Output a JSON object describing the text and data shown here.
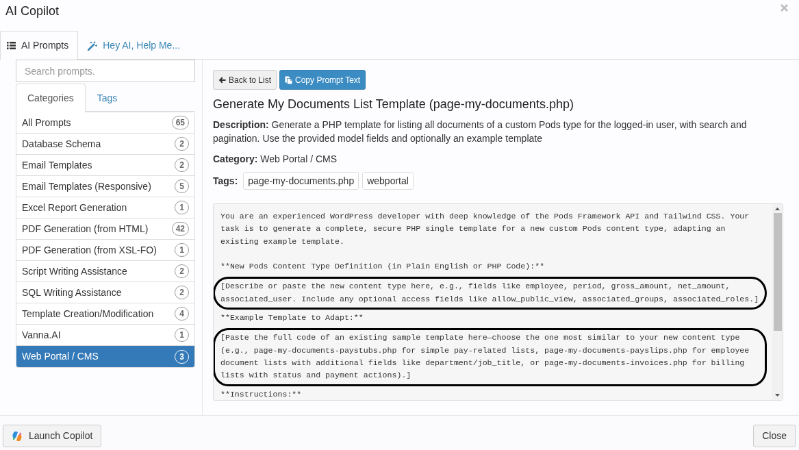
{
  "dialog": {
    "title": "AI Copilot"
  },
  "tabs": [
    {
      "label": "AI Prompts",
      "selected": true
    },
    {
      "label": "Hey AI, Help Me...",
      "selected": false
    }
  ],
  "sidebar": {
    "search": {
      "placeholder": "Search prompts."
    },
    "tabs": [
      {
        "label": "Categories",
        "selected": true
      },
      {
        "label": "Tags",
        "selected": false
      }
    ],
    "categories": [
      {
        "label": "All Prompts",
        "count": "65",
        "selected": false
      },
      {
        "label": "Database Schema",
        "count": "2",
        "selected": false
      },
      {
        "label": "Email Templates",
        "count": "2",
        "selected": false
      },
      {
        "label": "Email Templates (Responsive)",
        "count": "5",
        "selected": false
      },
      {
        "label": "Excel Report Generation",
        "count": "1",
        "selected": false
      },
      {
        "label": "PDF Generation (from HTML)",
        "count": "42",
        "selected": false
      },
      {
        "label": "PDF Generation (from XSL-FO)",
        "count": "1",
        "selected": false
      },
      {
        "label": "Script Writing Assistance",
        "count": "2",
        "selected": false
      },
      {
        "label": "SQL Writing Assistance",
        "count": "2",
        "selected": false
      },
      {
        "label": "Template Creation/Modification",
        "count": "4",
        "selected": false
      },
      {
        "label": "Vanna.AI",
        "count": "1",
        "selected": false
      },
      {
        "label": "Web Portal / CMS",
        "count": "3",
        "selected": true
      }
    ]
  },
  "detail": {
    "buttons": [
      {
        "label": "Back to List",
        "kind": "back"
      },
      {
        "label": "Copy Prompt Text",
        "kind": "copy"
      }
    ],
    "title": "Generate My Documents List Template (page-my-documents.php)",
    "description": "**Description:** Generate a PHP template for listing all documents of a custom Pods type for the logged-in user, with search and pagination. Use the provided model fields and optionally an example template",
    "category": "**Category:** Web Portal / CMS",
    "tags_label": "Tags:",
    "tags": [
      "page-my-documents.php",
      "webportal"
    ],
    "prompt": [
      {
        "text": "You are an experienced WordPress developer with deep knowledge of the Pods Framework API and Tailwind CSS. Your task is to generate a complete, secure PHP single template for a new custom Pods content type, adapting an existing example template.\n\n**New Pods Content Type Definition (in Plain English or PHP Code):**",
        "circled": false
      },
      {
        "text": "[Describe or paste the new content type here, e.g., fields like employee, period, gross_amount, net_amount, associated_user. Include any optional access fields like allow_public_view, associated_groups, associated_roles.]",
        "circled": true
      },
      {
        "text": "**Example Template to Adapt:**",
        "circled": false
      },
      {
        "text": "[Paste the full code of an existing sample template here—choose the one most similar to your new content type (e.g., page-my-documents-paystubs.php for simple pay-related lists, page-my-documents-payslips.php for employee document lists with additional fields like department/job_title, or page-my-documents-invoices.php for billing lists with status and payment actions).]",
        "circled": true
      },
      {
        "text": "**Instructions:**",
        "circled": false
      }
    ]
  },
  "footer": {
    "buttons": [
      {
        "label": "Launch Copilot",
        "kind": "launch"
      },
      {
        "label": "Close",
        "kind": "close"
      }
    ]
  }
}
